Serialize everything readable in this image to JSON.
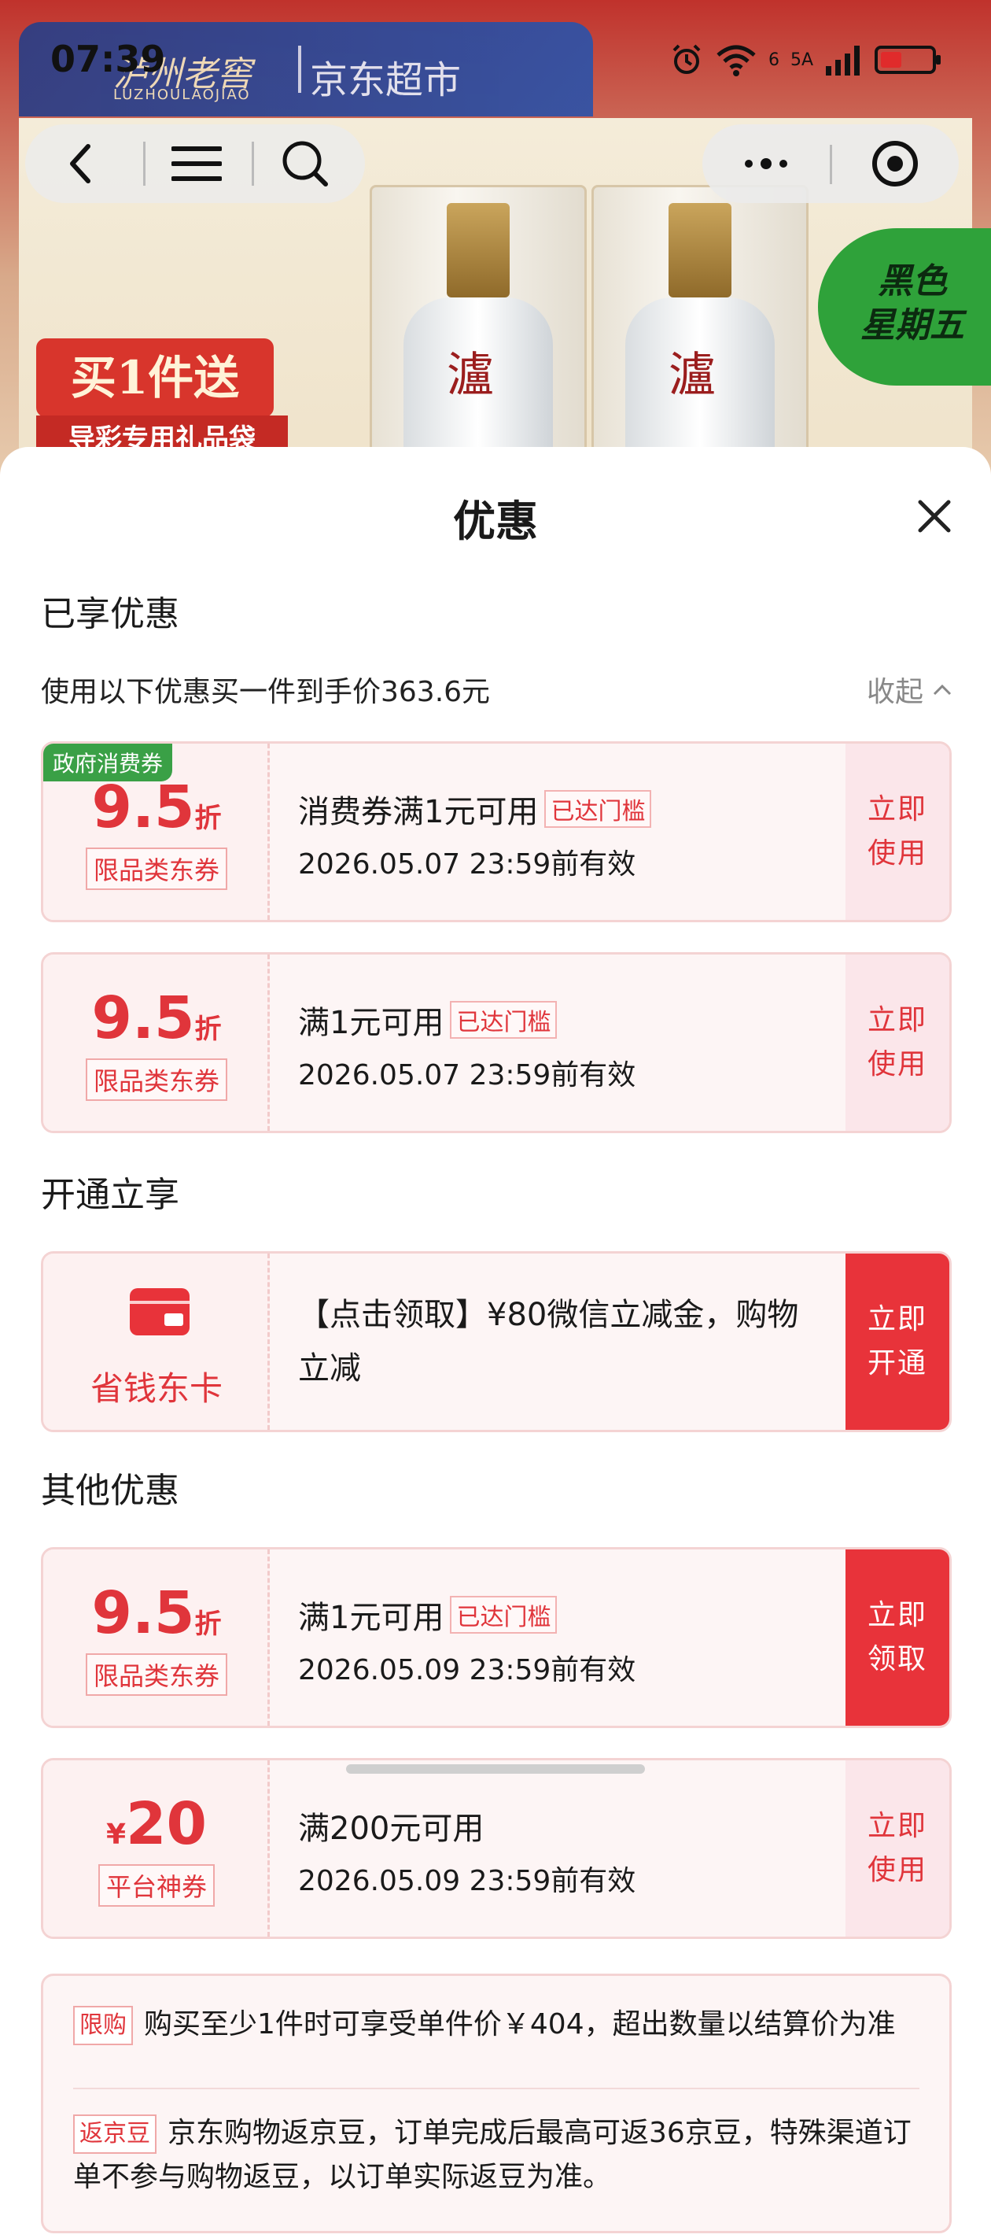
{
  "status_bar": {
    "time": "07:39",
    "net1": "6",
    "net2": "5A"
  },
  "background": {
    "brand_cn": "泸州老窖",
    "brand_en": "LUZHOULAOJIAO",
    "store": "京东超市",
    "promo": "买1件送",
    "promo_sub": "导彩专用礼品袋",
    "badge_line1": "黑色",
    "badge_line2": "星期五",
    "bottle_mark": "瀘"
  },
  "sheet": {
    "title": "优惠",
    "section_enjoyed": "已享优惠",
    "price_line": "使用以下优惠买一件到手价363.6元",
    "collapse_label": "收起",
    "section_open": "开通立享",
    "section_other": "其他优惠"
  },
  "coupons": [
    {
      "gov_tag": "政府消费券",
      "value": "9.5",
      "unit": "折",
      "type": "限品类东券",
      "title": "消费券满1元可用",
      "reached": "已达门槛",
      "date": "2026.05.07 23:59前有效",
      "action1": "立即",
      "action2": "使用"
    },
    {
      "value": "9.5",
      "unit": "折",
      "type": "限品类东券",
      "title": "满1元可用",
      "reached": "已达门槛",
      "date": "2026.05.07 23:59前有效",
      "action1": "立即",
      "action2": "使用"
    },
    {
      "card_label": "省钱东卡",
      "desc": "【点击领取】¥80微信立减金，购物立减",
      "action1": "立即",
      "action2": "开通"
    },
    {
      "value": "9.5",
      "unit": "折",
      "type": "限品类东券",
      "title": "满1元可用",
      "reached": "已达门槛",
      "date": "2026.05.09 23:59前有效",
      "action1": "立即",
      "action2": "领取"
    },
    {
      "yen": "¥",
      "value": "20",
      "type": "平台神券",
      "title": "满200元可用",
      "date": "2026.05.09 23:59前有效",
      "action1": "立即",
      "action2": "使用"
    }
  ],
  "notes": [
    {
      "tag": "限购",
      "text": "购买至少1件时可享受单件价￥404，超出数量以结算价为准"
    },
    {
      "tag": "返京豆",
      "text": "京东购物返京豆，订单完成后最高可返36京豆，特殊渠道订单不参与购物返豆，以订单实际返豆为准。"
    }
  ],
  "colors": {
    "accent": "#e8333a",
    "gov_green": "#3aa046"
  }
}
